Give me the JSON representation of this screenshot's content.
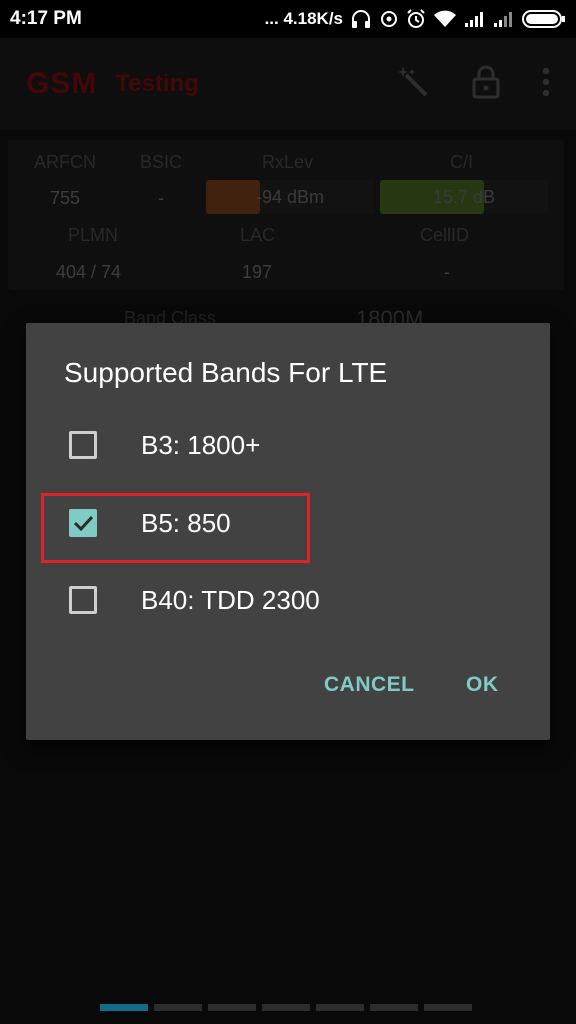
{
  "status_bar": {
    "time": "4:17 PM",
    "network_speed": "... 4.18K/s",
    "icons": [
      "headphones-icon",
      "sync-icon",
      "alarm-icon",
      "wifi-icon",
      "signal-icon",
      "signal-icon",
      "battery-icon"
    ]
  },
  "app_bar": {
    "title": "GSM",
    "subtitle": "Testing",
    "actions": [
      "magic-wand-icon",
      "lock-icon",
      "overflow-menu-icon"
    ]
  },
  "cell_info": {
    "arfcn_label": "ARFCN",
    "arfcn_value": "755",
    "bsic_label": "BSIC",
    "bsic_value": "-",
    "rxlev_label": "RxLev",
    "rxlev_value": "-94 dBm",
    "rxlev_level": 0.32,
    "ci_label": "C/I",
    "ci_value": "15.7 dB",
    "ci_level": 0.62,
    "plmn_label": "PLMN",
    "plmn_value": "404 / 74",
    "lac_label": "LAC",
    "lac_value": "197",
    "cellid_label": "CellID",
    "cellid_value": "-",
    "band_class_label": "Band Class",
    "band_class_value": "1800M"
  },
  "dialog": {
    "title": "Supported Bands For LTE",
    "options": [
      {
        "label": "B3: 1800+",
        "checked": false
      },
      {
        "label": "B5: 850",
        "checked": true
      },
      {
        "label": "B40: TDD 2300",
        "checked": false
      }
    ],
    "cancel_label": "CANCEL",
    "ok_label": "OK"
  },
  "colors": {
    "accent": "#80cbc4",
    "highlight": "#e0232b",
    "rxlev_bar": "#c85a12",
    "ci_bar": "#6aa820"
  },
  "pager": {
    "count": 7,
    "active_index": 0
  }
}
